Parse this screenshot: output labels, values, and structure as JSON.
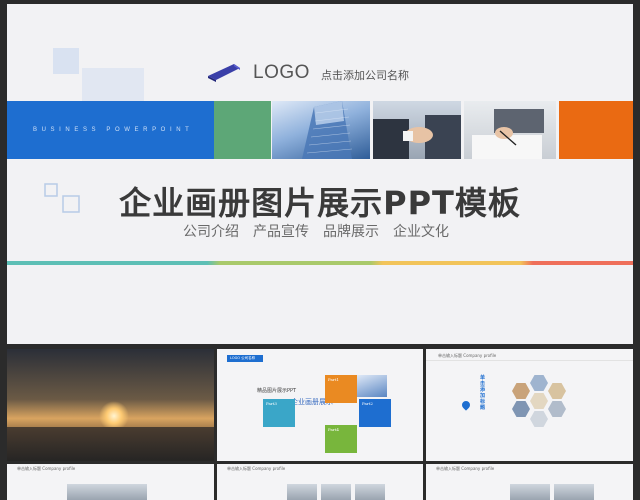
{
  "slide": {
    "logo_text": "LOGO",
    "company_placeholder": "点击添加公司名称",
    "banner_subtitle": "BUSINESS POWERPOINT",
    "title": "企业画册图片展示PPT模板",
    "subtitles": [
      "公司介绍",
      "产品宣传",
      "品牌展示",
      "企业文化"
    ]
  },
  "colors": {
    "blue": "#1e6ed0",
    "green": "#5da777",
    "orange": "#ea6a12",
    "title": "#3a3a3a"
  },
  "thumbnails": {
    "t2": {
      "tag": "LOGO 公司名称",
      "title_a": "精品图片展示PPT",
      "title_b": "企业画册展示",
      "parts": [
        "Part1",
        "Part2",
        "Part3",
        "Part4"
      ]
    },
    "t3": {
      "header": "单击输入标题 Company profile",
      "click_text": "单击添加标题"
    },
    "t4": {
      "header": "单击输入标题 Company profile"
    },
    "t5": {
      "header": "单击输入标题 Company profile"
    },
    "t6": {
      "header": "单击输入标题 Company profile"
    }
  },
  "icons": [
    "logo-mark-icon",
    "location-pin-icon",
    "frame-squares-icon"
  ]
}
